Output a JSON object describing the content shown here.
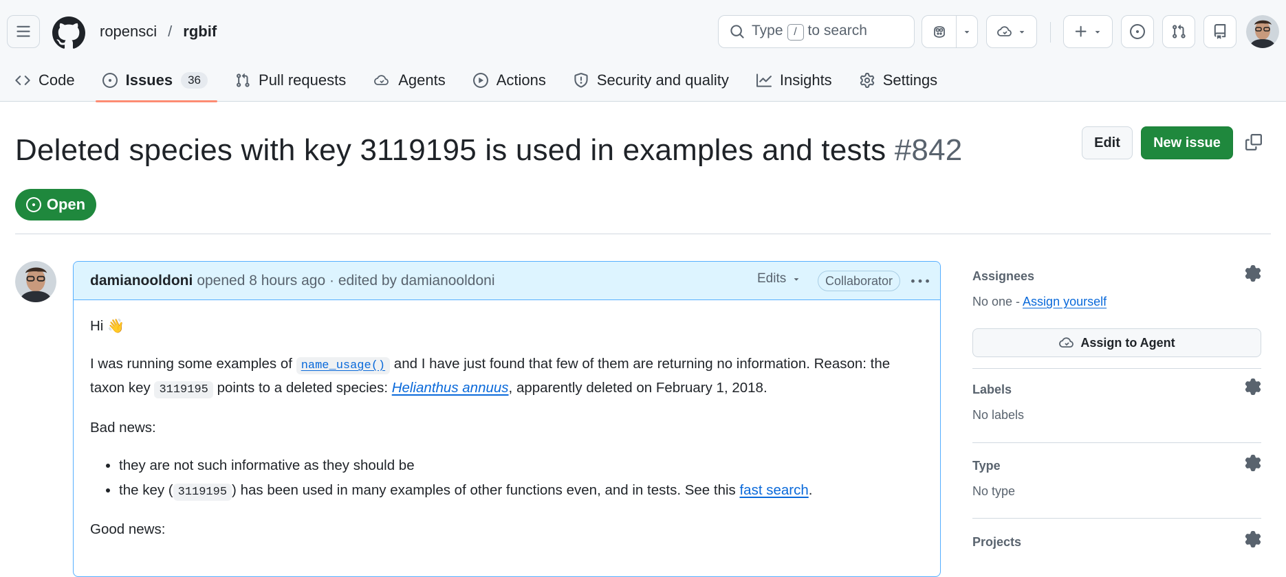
{
  "header": {
    "owner": "ropensci",
    "separator": "/",
    "repo": "rgbif",
    "search_pre": "Type",
    "search_key": "/",
    "search_post": "to search"
  },
  "tabs": [
    {
      "label": "Code",
      "icon": "code-icon"
    },
    {
      "label": "Issues",
      "icon": "issue-opened-icon",
      "count": "36"
    },
    {
      "label": "Pull requests",
      "icon": "git-pull-request-icon"
    },
    {
      "label": "Agents",
      "icon": "agent-cloud-icon"
    },
    {
      "label": "Actions",
      "icon": "play-icon"
    },
    {
      "label": "Security and quality",
      "icon": "shield-icon"
    },
    {
      "label": "Insights",
      "icon": "graph-icon"
    },
    {
      "label": "Settings",
      "icon": "gear-icon"
    }
  ],
  "issue": {
    "title": "Deleted species with key 3119195 is used in examples and tests",
    "number": "#842",
    "edit_label": "Edit",
    "new_label": "New issue",
    "state": "Open"
  },
  "comment": {
    "author": "damianooldoni",
    "meta": "opened 8 hours ago · edited by damianooldoni",
    "edits_label": "Edits",
    "role": "Collaborator",
    "greeting": "Hi",
    "greeting_emoji": "👋",
    "p1_a": "I was running some examples of ",
    "p1_code": "name_usage()",
    "p1_b": " and I have just found that few of them are returning no information. Reason: the taxon key ",
    "p1_code2": "3119195",
    "p1_c": " points to a deleted species: ",
    "p1_link": "Helianthus annuus",
    "p1_d": ", apparently deleted on February 1, 2018.",
    "bad_news": "Bad news:",
    "li1": "they are not such informative as they should be",
    "li2_a": "the key (",
    "li2_code": "3119195",
    "li2_b": ") has been used in many examples of other functions even, and in tests. See this ",
    "li2_link": "fast search",
    "li2_c": ".",
    "good_news": "Good news:"
  },
  "sidebar": {
    "assignees_label": "Assignees",
    "assignees_none": "No one - ",
    "assign_yourself": "Assign yourself",
    "assign_agent": "Assign to Agent",
    "labels_label": "Labels",
    "labels_value": "No labels",
    "type_label": "Type",
    "type_value": "No type",
    "projects_label": "Projects"
  },
  "colors": {
    "accent_green": "#1f883d",
    "link_blue": "#0969da",
    "tab_underline": "#fd8c73",
    "comment_header_bg": "#ddf4ff"
  }
}
